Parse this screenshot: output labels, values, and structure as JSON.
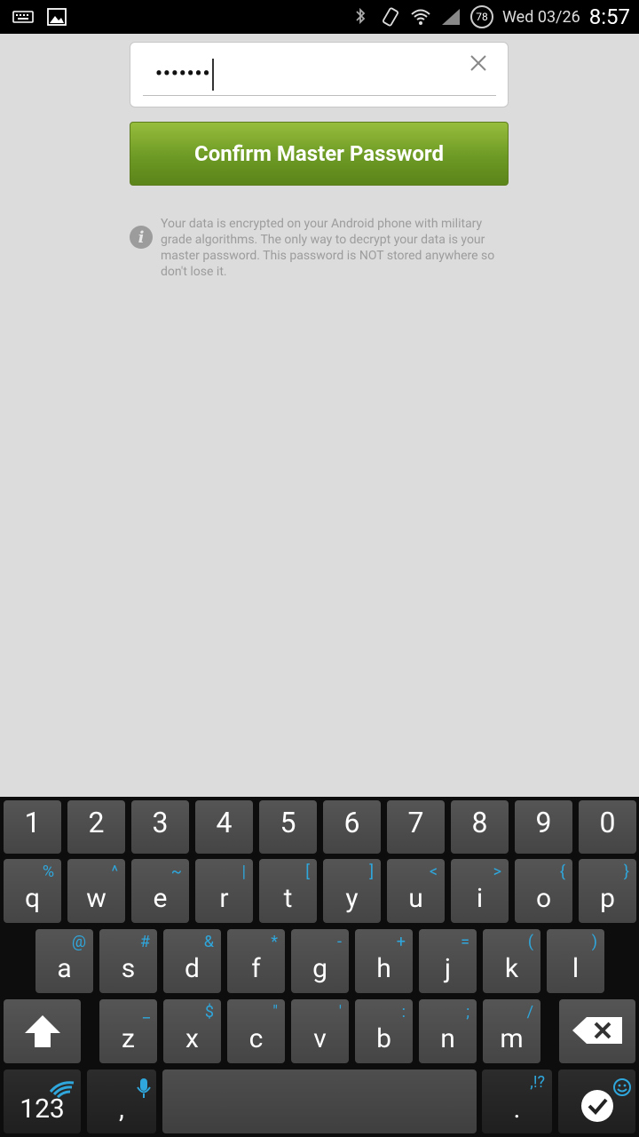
{
  "status_bar": {
    "date": "Wed 03/26",
    "time": "8:57",
    "battery": "78"
  },
  "password_field": {
    "value": "•••••••"
  },
  "confirm_button": {
    "label": "Confirm Master Password"
  },
  "info": {
    "text": "Your data is encrypted on your Android phone with military grade algorithms. The only way to decrypt your data is your master password. This password is NOT stored anywhere so don't lose it."
  },
  "keyboard": {
    "numbers": [
      "1",
      "2",
      "3",
      "4",
      "5",
      "6",
      "7",
      "8",
      "9",
      "0"
    ],
    "row1": [
      {
        "main": "q",
        "alt": "%"
      },
      {
        "main": "w",
        "alt": "^"
      },
      {
        "main": "e",
        "alt": "~"
      },
      {
        "main": "r",
        "alt": "|"
      },
      {
        "main": "t",
        "alt": "["
      },
      {
        "main": "y",
        "alt": "]"
      },
      {
        "main": "u",
        "alt": "<"
      },
      {
        "main": "i",
        "alt": ">"
      },
      {
        "main": "o",
        "alt": "{"
      },
      {
        "main": "p",
        "alt": "}"
      }
    ],
    "row2": [
      {
        "main": "a",
        "alt": "@"
      },
      {
        "main": "s",
        "alt": "#"
      },
      {
        "main": "d",
        "alt": "&"
      },
      {
        "main": "f",
        "alt": "*"
      },
      {
        "main": "g",
        "alt": "-"
      },
      {
        "main": "h",
        "alt": "+"
      },
      {
        "main": "j",
        "alt": "="
      },
      {
        "main": "k",
        "alt": "("
      },
      {
        "main": "l",
        "alt": ")"
      }
    ],
    "row3": [
      {
        "main": "z",
        "alt": "_"
      },
      {
        "main": "x",
        "alt": "$"
      },
      {
        "main": "c",
        "alt": "\""
      },
      {
        "main": "v",
        "alt": "'"
      },
      {
        "main": "b",
        "alt": ":"
      },
      {
        "main": "n",
        "alt": ";"
      },
      {
        "main": "m",
        "alt": "/"
      }
    ],
    "numbers_mode": "123",
    "comma": ",",
    "period": ".",
    "period_alt": ",!?"
  }
}
